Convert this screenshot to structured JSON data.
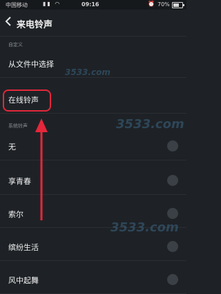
{
  "statusbar": {
    "carrier": "中国移动",
    "time": "09:16",
    "battery": "70%",
    "battery_level": 0.7
  },
  "header": {
    "title": "来电铃声"
  },
  "sections": {
    "custom_label": "自定义",
    "system_label": "系统铃声"
  },
  "custom_items": [
    {
      "label": "从文件中选择"
    },
    {
      "label": "在线铃声"
    }
  ],
  "system_items": [
    {
      "label": "无"
    },
    {
      "label": "享青春"
    },
    {
      "label": "索尔"
    },
    {
      "label": "缤纷生活"
    },
    {
      "label": "风中起舞"
    }
  ],
  "watermark": "3533.com",
  "colors": {
    "accent": "#e6273b",
    "background": "#1e2226"
  }
}
